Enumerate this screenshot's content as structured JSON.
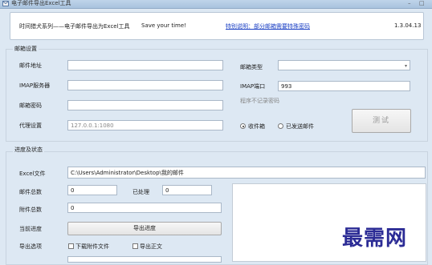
{
  "window": {
    "title": "电子邮件导出Excel工具",
    "minimize_glyph": "–",
    "maximize_glyph": "□"
  },
  "header": {
    "app_name": "时间猎犬系列——电子邮件导出为Excel工具",
    "slogan": "Save your time!",
    "notice_link": "特别说明：部分邮箱需要特殊密码",
    "version": "1.3.04.13"
  },
  "mailbox_settings": {
    "section_title": "邮箱设置",
    "email_label": "邮件地址",
    "email_value": "",
    "imap_server_label": "IMAP服务器",
    "imap_server_value": "",
    "password_label": "邮箱密码",
    "password_value": "",
    "proxy_label": "代理设置",
    "proxy_value": "127.0.0.1:1080",
    "mailbox_type_label": "邮箱类型",
    "mailbox_type_value": "",
    "imap_port_label": "IMAP端口",
    "imap_port_value": "993",
    "password_hint": "程序不记录密码",
    "radio_inbox_label": "收件箱",
    "radio_sent_label": "已发送邮件",
    "radio_selected": "inbox",
    "test_button_label": "测试"
  },
  "progress_status": {
    "section_title": "进度及状态",
    "excel_label": "Excel文件",
    "excel_path": "C:\\Users\\Administrator\\Desktop\\我的邮件",
    "total_mail_label": "邮件总数",
    "total_mail_value": "0",
    "processed_label": "已处理",
    "processed_value": "0",
    "attachments_label": "附件总数",
    "attachments_value": "0",
    "current_progress_label": "当前进度",
    "export_button_label": "导出进度",
    "export_options_label": "导出选项",
    "option_download_attachments": "下载附件文件",
    "option_export_body": "导出正文",
    "option_download_checked": false,
    "option_body_checked": false
  },
  "watermark_text": "最需网"
}
